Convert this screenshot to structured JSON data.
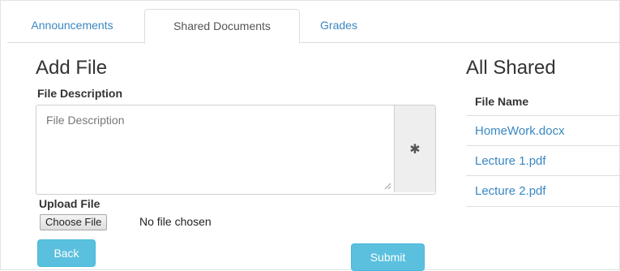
{
  "tabs": [
    {
      "label": "Announcements",
      "active": false
    },
    {
      "label": "Shared Documents",
      "active": true
    },
    {
      "label": "Grades",
      "active": false
    }
  ],
  "add_file": {
    "title": "Add File",
    "description_label": "File Description",
    "description_placeholder": "File Description",
    "addon_icon": "asterisk-icon",
    "upload_label": "Upload File",
    "choose_button": "Choose File",
    "no_file_text": "No file chosen",
    "back_button": "Back",
    "submit_button": "Submit"
  },
  "all_shared": {
    "title": "All Shared",
    "column_header": "File Name",
    "files": [
      "HomeWork.docx",
      "Lecture 1.pdf",
      "Lecture 2.pdf"
    ]
  },
  "colors": {
    "link": "#3a87c2",
    "button": "#5bc0de",
    "border": "#dddddd",
    "addon_bg": "#eeeeee"
  }
}
